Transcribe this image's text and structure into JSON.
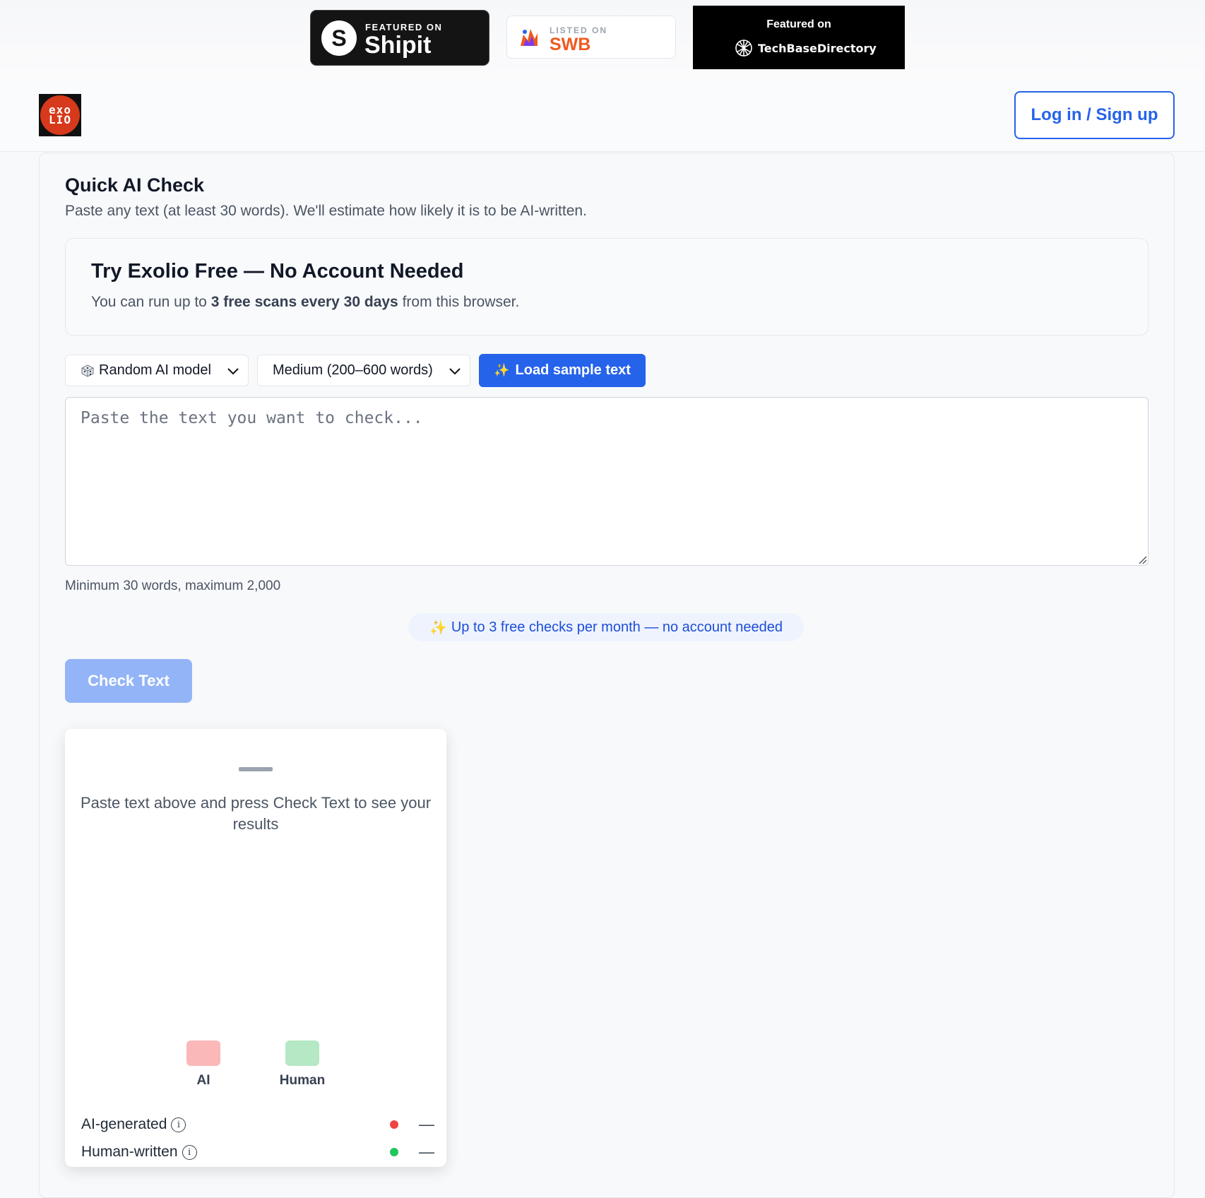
{
  "featured": {
    "shipit": {
      "small": "FEATURED ON",
      "big": "Shipit",
      "letter": "S"
    },
    "swb": {
      "small": "LISTED ON",
      "big": "SWB"
    },
    "techbase": {
      "top": "Featured on",
      "bottom": "TechBaseDirectory"
    }
  },
  "header": {
    "logo_line1": "exo",
    "logo_line2": "LIO",
    "login_label": "Log in / Sign up"
  },
  "main": {
    "title": "Quick AI Check",
    "subtitle": "Paste any text (at least 30 words). We'll estimate how likely it is to be AI-written.",
    "promo": {
      "title": "Try Exolio Free — No Account Needed",
      "text_before": "You can run up to ",
      "text_bold": "3 free scans every 30 days",
      "text_after": " from this browser."
    },
    "model_select": {
      "selected": "Random AI model",
      "icon": "dice-icon"
    },
    "length_select": {
      "selected": "Medium (200–600 words)"
    },
    "sample_button": {
      "icon": "✨",
      "label": "Load sample text"
    },
    "textarea": {
      "placeholder": "Paste the text you want to check...",
      "value": ""
    },
    "helper": "Minimum 30 words, maximum 2,000",
    "free_pill": {
      "icon": "✨",
      "label": "Up to 3 free checks per month — no account needed"
    },
    "check_button": "Check Text"
  },
  "results": {
    "placeholder": "Paste text above and press Check Text to see your results",
    "legend": [
      {
        "label": "AI",
        "color": "#fbb8b8"
      },
      {
        "label": "Human",
        "color": "#b5e8c4"
      }
    ],
    "metrics": [
      {
        "label": "AI-generated",
        "dot_color": "#ef4444",
        "value": "—"
      },
      {
        "label": "Human-written",
        "dot_color": "#22c55e",
        "value": "—"
      }
    ]
  },
  "colors": {
    "accent": "#2563eb",
    "check_button_disabled": "#93b4f6",
    "logo_red": "#d6391b"
  }
}
